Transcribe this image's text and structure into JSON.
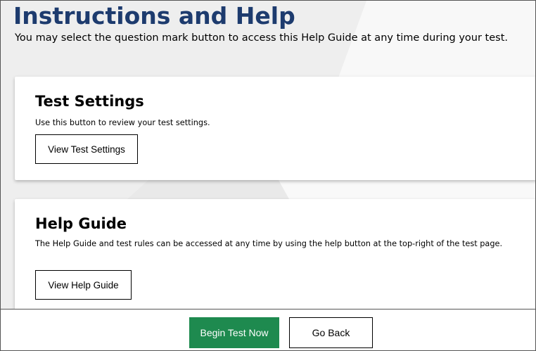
{
  "header": {
    "title": "Instructions and Help",
    "subtitle": "You may select the question mark button to access this Help Guide at any time during your test."
  },
  "sections": {
    "test_settings": {
      "title": "Test Settings",
      "description": "Use this button to review your test settings.",
      "button_label": "View Test Settings"
    },
    "help_guide": {
      "title": "Help Guide",
      "description": "The Help Guide and test rules can be accessed at any time by using the help button at the top-right of the test page.",
      "button_label": "View Help Guide"
    }
  },
  "footer": {
    "begin_label": "Begin Test Now",
    "back_label": "Go Back"
  },
  "colors": {
    "title": "#1d3b6e",
    "primary_button": "#1e8a4f",
    "background": "#f3f3f3"
  }
}
